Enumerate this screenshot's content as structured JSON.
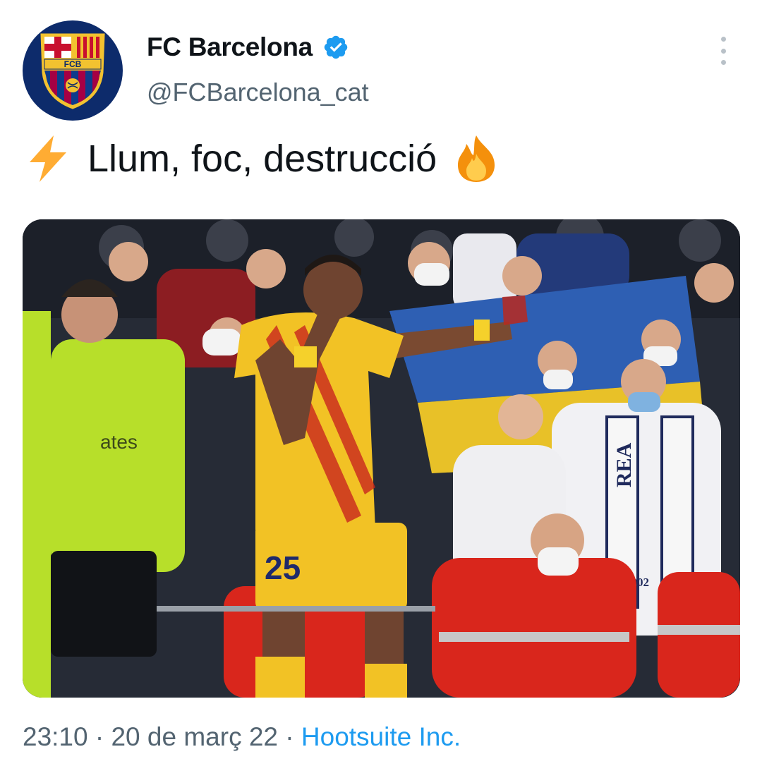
{
  "author": {
    "display_name": "FC Barcelona",
    "handle": "@FCBarcelona_cat",
    "verified": true,
    "avatar_icon": "fcb-crest-icon",
    "crest_text": "FCB"
  },
  "tweet": {
    "leading_emoji": "lightning-emoji",
    "text": "Llum, foc, destrucció",
    "trailing_emoji": "fire-emoji"
  },
  "media": {
    "type": "photo",
    "jersey_number": "25",
    "scarf_text": "REA",
    "scarf_year": "1902",
    "bib_text": "ates"
  },
  "meta": {
    "time": "23:10",
    "separator_1": "·",
    "date": "20 de març 22",
    "separator_2": "·",
    "source": "Hootsuite Inc."
  },
  "colors": {
    "verified_blue": "#1d9bf0",
    "link_blue": "#1d9bf0",
    "secondary_text": "#536471",
    "barca_blue": "#0d2b6b"
  }
}
